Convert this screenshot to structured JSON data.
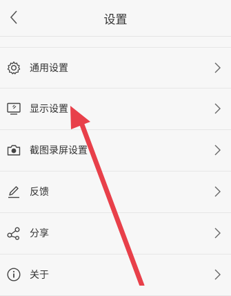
{
  "header": {
    "title": "设置",
    "back_icon": "chevron-left-icon"
  },
  "menu": [
    {
      "id": "general",
      "label": "通用设置",
      "icon": "gear-icon"
    },
    {
      "id": "display",
      "label": "显示设置",
      "icon": "monitor-icon"
    },
    {
      "id": "screenshot",
      "label": "截图录屏设置",
      "icon": "camera-icon"
    },
    {
      "id": "feedback",
      "label": "反馈",
      "icon": "pencil-icon"
    },
    {
      "id": "share",
      "label": "分享",
      "icon": "share-icon"
    },
    {
      "id": "about",
      "label": "关于",
      "icon": "info-icon"
    }
  ],
  "colors": {
    "background": "#f7f7f7",
    "annotation_arrow": "#e8404a",
    "icon": "#444444",
    "chevron": "#666666"
  }
}
